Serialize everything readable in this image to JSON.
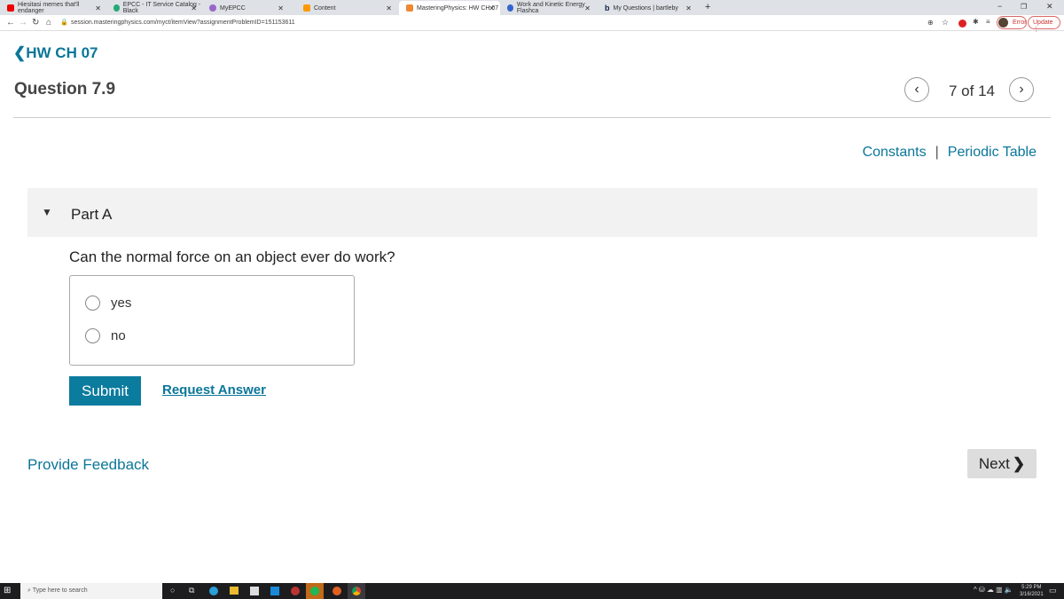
{
  "browser": {
    "tabs": [
      {
        "label": "Hiesitasi memes that'll endanger",
        "color": "#e00"
      },
      {
        "label": "EPCC - IT Service Catalog - Black",
        "color": "#2a7"
      },
      {
        "label": "MyEPCC",
        "color": "#96c"
      },
      {
        "label": "Content",
        "color": "#f90"
      },
      {
        "label": "MasteringPhysics: HW CH 07",
        "color": "#e83"
      },
      {
        "label": "Work and Kinetic Energy Flashca",
        "color": "#36c"
      },
      {
        "label": "My Questions | bartleby",
        "color": "#124"
      }
    ],
    "url": "session.masteringphysics.com/myct/itemView?assignmentProblemID=151153611",
    "error_label": "Error",
    "update_label": "Update"
  },
  "page": {
    "back_link": "HW CH 07",
    "title": "Question 7.9",
    "pager": "7 of 14",
    "constants": "Constants",
    "separator": "|",
    "periodic_table": "Periodic Table",
    "part_label": "Part A",
    "question": "Can the normal force on an object ever do work?",
    "options": [
      "yes",
      "no"
    ],
    "submit": "Submit",
    "request_answer": "Request Answer",
    "feedback": "Provide Feedback",
    "next": "Next"
  },
  "taskbar": {
    "search_placeholder": "Type here to search",
    "time": "5:29 PM",
    "date": "3/16/2021"
  }
}
